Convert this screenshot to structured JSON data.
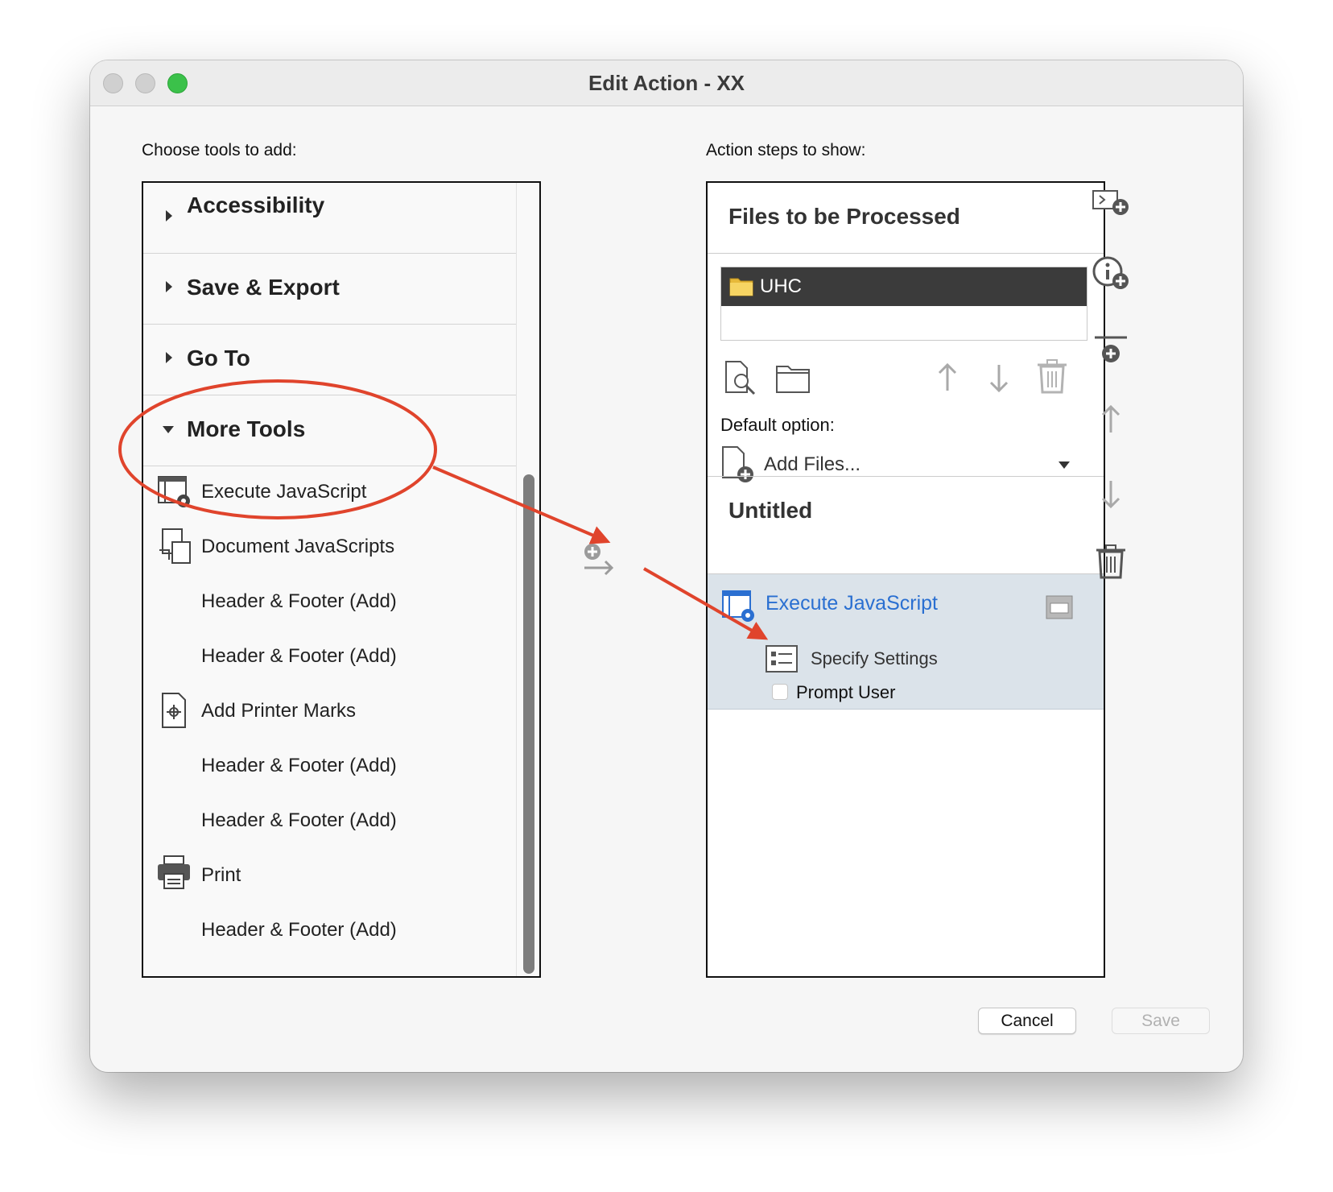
{
  "window": {
    "title": "Edit Action - XX"
  },
  "left": {
    "label": "Choose tools to add:",
    "categories": [
      {
        "label": "Accessibility",
        "expanded": false
      },
      {
        "label": "Save & Export",
        "expanded": false
      },
      {
        "label": "Go To",
        "expanded": false
      },
      {
        "label": "More Tools",
        "expanded": true
      }
    ],
    "tools": [
      {
        "label": "Execute JavaScript",
        "icon": "execute-javascript-icon"
      },
      {
        "label": "Document JavaScripts",
        "icon": "document-javascripts-icon"
      },
      {
        "label": "Header & Footer (Add)",
        "icon": ""
      },
      {
        "label": "Header & Footer (Add)",
        "icon": ""
      },
      {
        "label": "Add Printer Marks",
        "icon": "printer-marks-icon"
      },
      {
        "label": "Header & Footer (Add)",
        "icon": ""
      },
      {
        "label": "Header & Footer (Add)",
        "icon": ""
      },
      {
        "label": "Print",
        "icon": "printer-icon"
      },
      {
        "label": "Header & Footer (Add)",
        "icon": ""
      }
    ]
  },
  "right": {
    "label": "Action steps to show:",
    "files_header": "Files to be Processed",
    "file_item": "UHC",
    "default_option_label": "Default option:",
    "default_option_value": "Add Files...",
    "untitled_header": "Untitled",
    "step": {
      "label": "Execute JavaScript",
      "settings_label": "Specify Settings",
      "prompt_label": "Prompt User",
      "prompt_checked": false
    }
  },
  "buttons": {
    "cancel": "Cancel",
    "save": "Save"
  },
  "colors": {
    "annotation_red": "#e0442c",
    "accent_link": "#2a6fd1",
    "selection_dark": "#3b3b3b",
    "traffic_green": "#3bc14a"
  }
}
